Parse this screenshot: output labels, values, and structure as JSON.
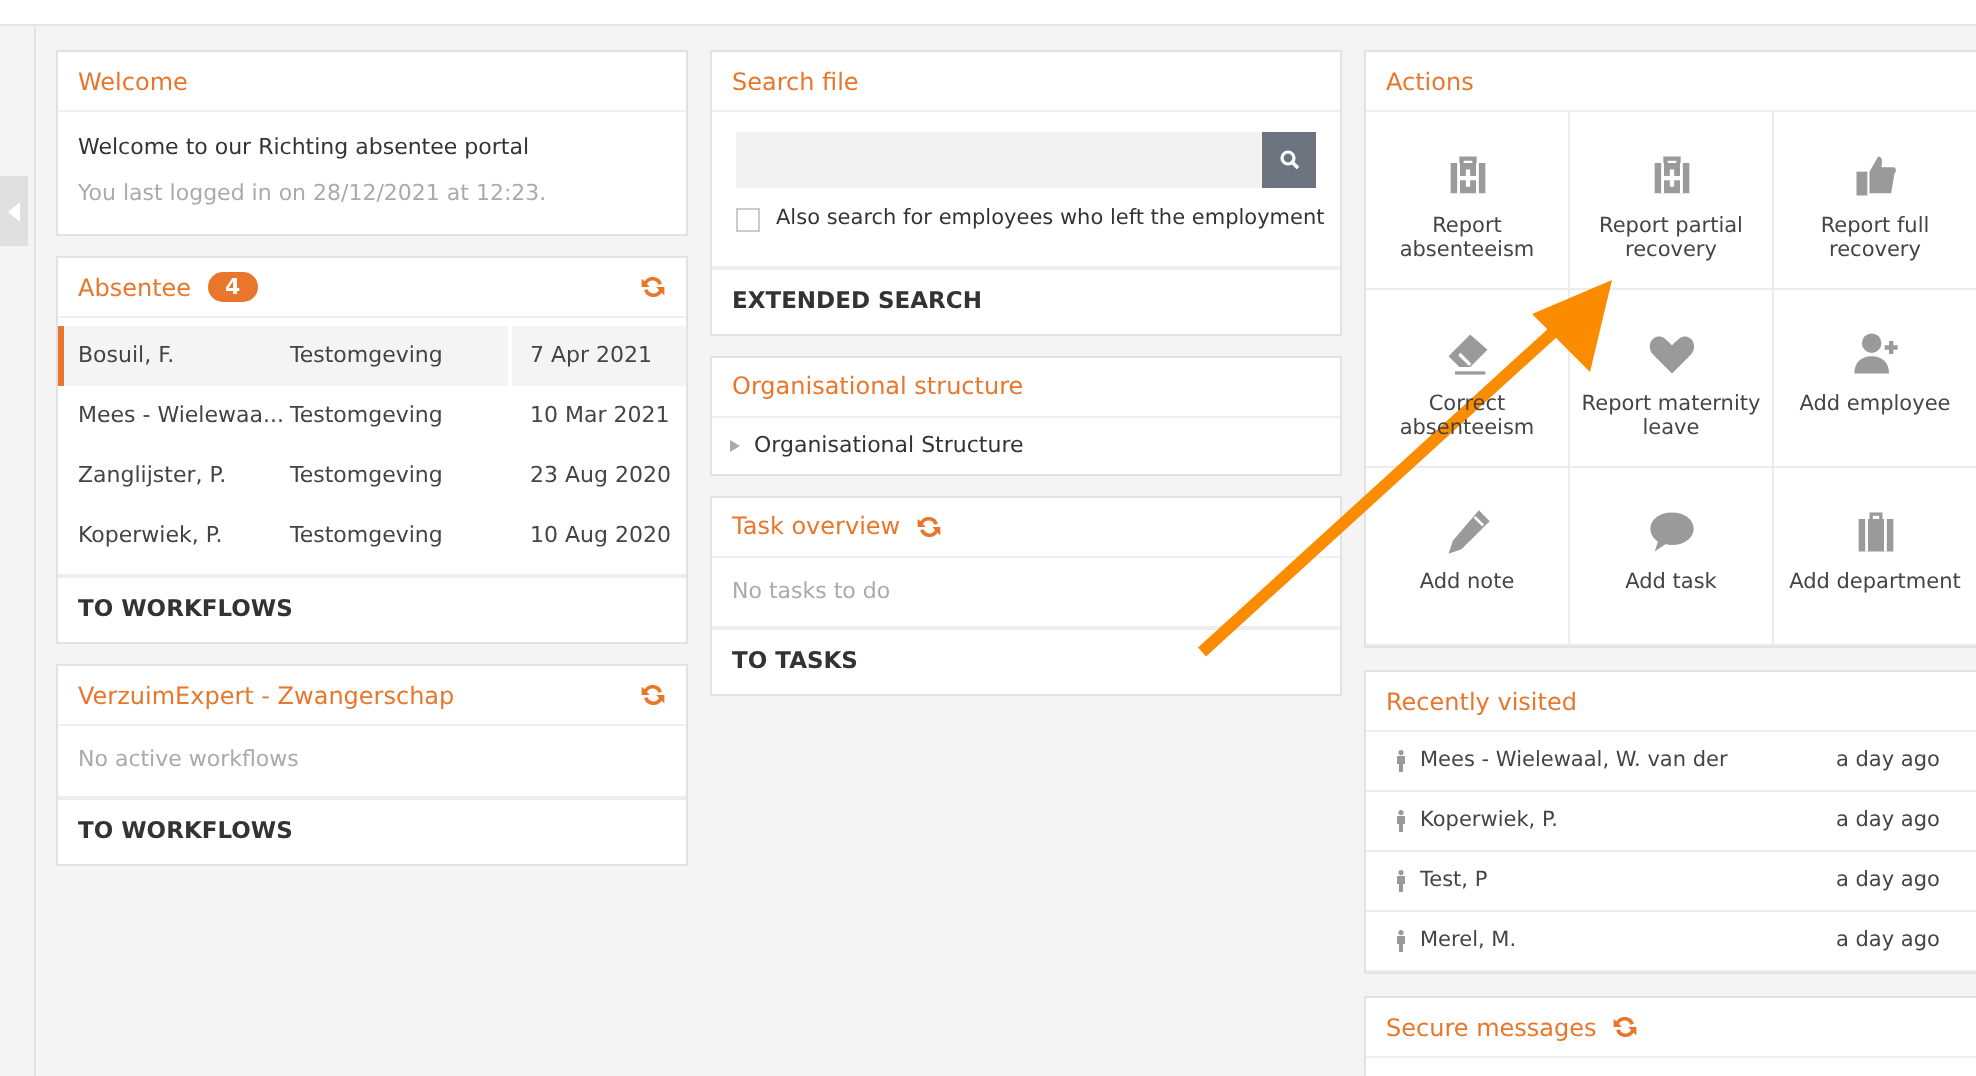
{
  "welcome": {
    "title": "Welcome",
    "message": "Welcome to our Richting absentee portal",
    "last_login": "You last logged in on 28/12/2021 at 12:23."
  },
  "absentee": {
    "title": "Absentee",
    "count": "4",
    "rows": [
      {
        "name": "Bosuil, F.",
        "environment": "Testomgeving",
        "date": "7 Apr 2021",
        "selected": true
      },
      {
        "name": "Mees - Wielewaa...",
        "environment": "Testomgeving",
        "date": "10 Mar 2021",
        "selected": false
      },
      {
        "name": "Zanglijster, P.",
        "environment": "Testomgeving",
        "date": "23 Aug 2020",
        "selected": false
      },
      {
        "name": "Koperwiek, P.",
        "environment": "Testomgeving",
        "date": "10 Aug 2020",
        "selected": false
      }
    ],
    "footer": "TO WORKFLOWS"
  },
  "verzuimexpert": {
    "title": "VerzuimExpert - Zwangerschap",
    "empty": "No active workflows",
    "footer": "TO WORKFLOWS"
  },
  "search_file": {
    "title": "Search file",
    "checkbox": {
      "label": "Also search for employees who left the employment",
      "checked": false
    },
    "footer": "EXTENDED SEARCH"
  },
  "organisational_structure": {
    "title": "Organisational structure",
    "items": [
      {
        "label": "Organisational Structure",
        "expanded": false
      }
    ]
  },
  "task_overview": {
    "title": "Task overview",
    "empty": "No tasks to do",
    "footer": "TO TASKS"
  },
  "actions": {
    "title": "Actions",
    "items": [
      {
        "label": "Report absenteeism"
      },
      {
        "label": "Report partial recovery"
      },
      {
        "label": "Report full recovery"
      },
      {
        "label": "Correct absenteeism"
      },
      {
        "label": "Report maternity leave"
      },
      {
        "label": "Add employee"
      },
      {
        "label": "Add note"
      },
      {
        "label": "Add task"
      },
      {
        "label": "Add department"
      }
    ]
  },
  "recently_visited": {
    "title": "Recently visited",
    "items": [
      {
        "name": "Mees - Wielewaal, W. van der",
        "time": "a day ago"
      },
      {
        "name": "Koperwiek, P.",
        "time": "a day ago"
      },
      {
        "name": "Test, P",
        "time": "a day ago"
      },
      {
        "name": "Merel, M.",
        "time": "a day ago"
      }
    ]
  },
  "secure_messages": {
    "title": "Secure messages"
  }
}
